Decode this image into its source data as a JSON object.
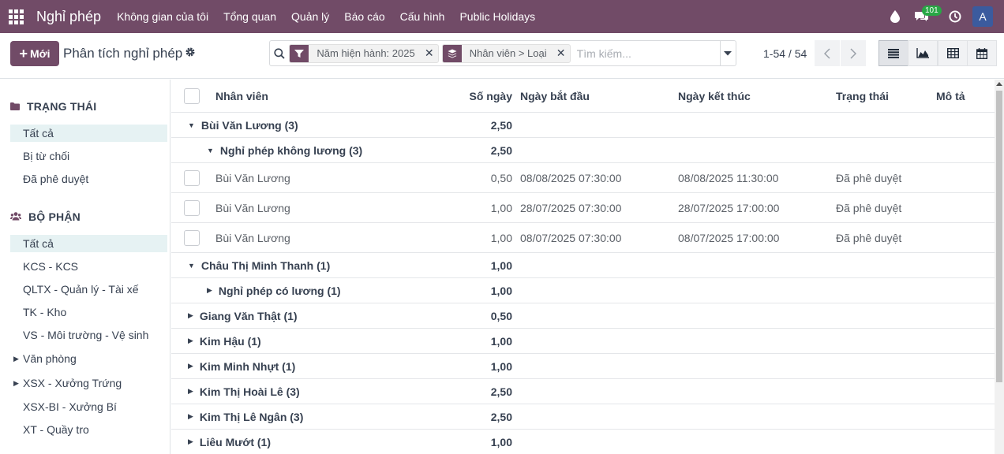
{
  "navbar": {
    "brand": "Nghỉ phép",
    "menu": [
      "Không gian của tôi",
      "Tổng quan",
      "Quản lý",
      "Báo cáo",
      "Cấu hình",
      "Public Holidays"
    ],
    "messages_count": "101",
    "avatar": "A"
  },
  "control": {
    "new_label": "Mới",
    "page_title": "Phân tích nghỉ phép",
    "facets": [
      {
        "label": "Năm hiện hành: 2025",
        "icon": "filter-icon"
      },
      {
        "label": "Nhân viên > Loại",
        "icon": "layers-icon"
      }
    ],
    "search_placeholder": "Tìm kiếm...",
    "pager": "1-54 / 54"
  },
  "sidebar": {
    "status_header": "TRẠNG THÁI",
    "status_items": [
      "Tất cả",
      "Bị từ chối",
      "Đã phê duyệt"
    ],
    "dept_header": "BỘ PHẬN",
    "dept_items": [
      "Tất cả",
      "KCS - KCS",
      "QLTX - Quản lý - Tài xế",
      "TK - Kho",
      "VS - Môi trường - Vệ sinh",
      "Văn phòng",
      "XSX - Xưởng Trứng",
      "XSX-BI - Xưởng Bí",
      "XT - Quầy tro"
    ]
  },
  "table": {
    "columns": [
      "Nhân viên",
      "Số ngày",
      "Ngày bắt đầu",
      "Ngày kết thúc",
      "Trạng thái",
      "Mô tả"
    ],
    "rows": [
      {
        "kind": "group",
        "level": 0,
        "open": true,
        "label": "Bùi Văn Lương (3)",
        "days": "2,50"
      },
      {
        "kind": "group",
        "level": 1,
        "open": true,
        "label": "Nghỉ phép không lương (3)",
        "days": "2,50"
      },
      {
        "kind": "record",
        "name": "Bùi Văn Lương",
        "days": "0,50",
        "start": "08/08/2025 07:30:00",
        "end": "08/08/2025 11:30:00",
        "status": "Đã phê duyệt"
      },
      {
        "kind": "record",
        "name": "Bùi Văn Lương",
        "days": "1,00",
        "start": "28/07/2025 07:30:00",
        "end": "28/07/2025 17:00:00",
        "status": "Đã phê duyệt"
      },
      {
        "kind": "record",
        "name": "Bùi Văn Lương",
        "days": "1,00",
        "start": "08/07/2025 07:30:00",
        "end": "08/07/2025 17:00:00",
        "status": "Đã phê duyệt"
      },
      {
        "kind": "group",
        "level": 0,
        "open": true,
        "label": "Châu Thị Minh Thanh (1)",
        "days": "1,00"
      },
      {
        "kind": "group",
        "level": 1,
        "open": false,
        "label": "Nghỉ phép có lương (1)",
        "days": "1,00"
      },
      {
        "kind": "group",
        "level": 0,
        "open": false,
        "label": "Giang Văn Thật (1)",
        "days": "0,50"
      },
      {
        "kind": "group",
        "level": 0,
        "open": false,
        "label": "Kim Hậu (1)",
        "days": "1,00"
      },
      {
        "kind": "group",
        "level": 0,
        "open": false,
        "label": "Kim Minh Nhựt (1)",
        "days": "1,00"
      },
      {
        "kind": "group",
        "level": 0,
        "open": false,
        "label": "Kim Thị Hoài Lê (3)",
        "days": "2,50"
      },
      {
        "kind": "group",
        "level": 0,
        "open": false,
        "label": "Kim Thị Lê Ngân (3)",
        "days": "2,50"
      },
      {
        "kind": "group",
        "level": 0,
        "open": false,
        "label": "Liêu Mướt (1)",
        "days": "1,00"
      }
    ]
  }
}
